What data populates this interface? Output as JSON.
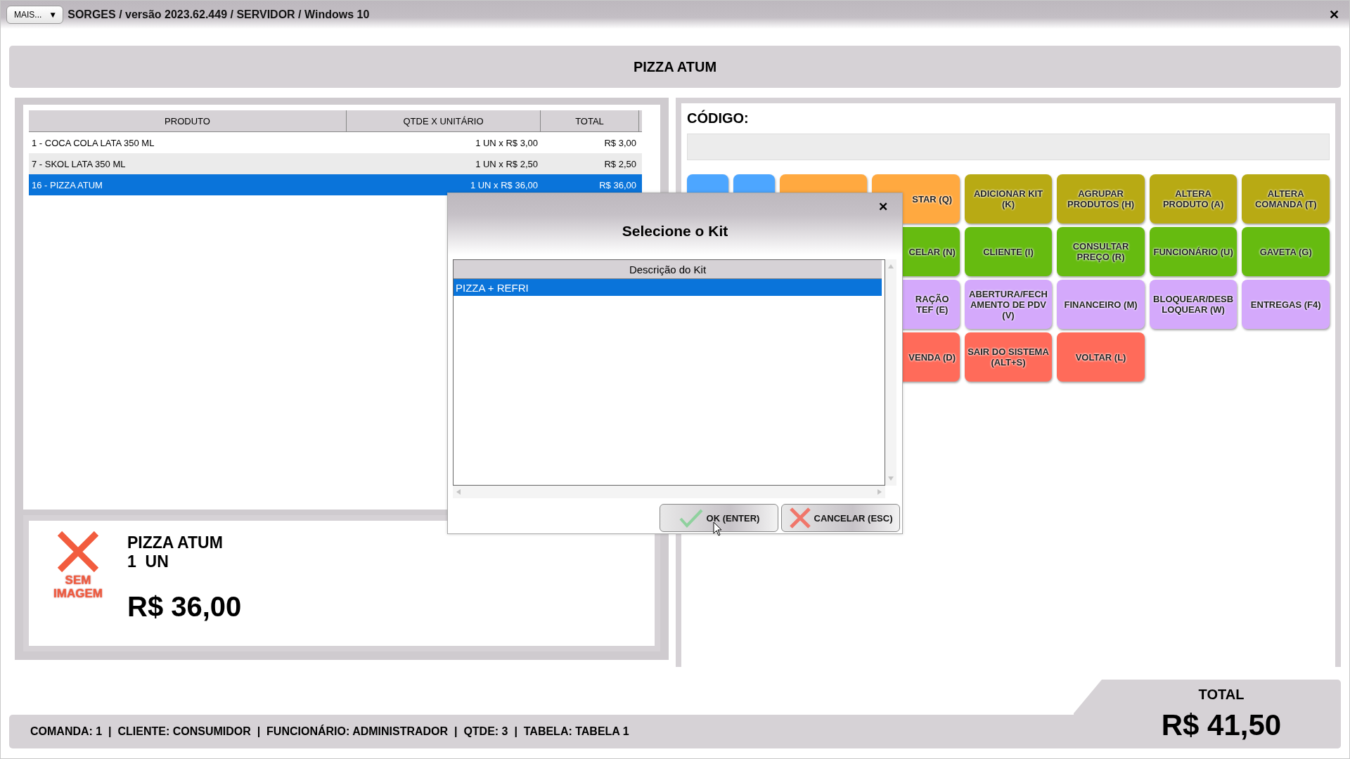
{
  "title_bar": {
    "menu_button": "MAIS...",
    "menu_caret": "▼",
    "title": "SORGES / versão 2023.62.449 / SERVIDOR / Windows 10",
    "close": "✕"
  },
  "header": {
    "product": "PIZZA ATUM"
  },
  "items_table": {
    "columns": [
      "PRODUTO",
      "QTDE X UNITÁRIO",
      "TOTAL"
    ],
    "rows": [
      {
        "product": "1 - COCA COLA LATA 350 ML",
        "quantity": "1 UN x R$ 3,00",
        "total": "R$ 3,00",
        "selected": false
      },
      {
        "product": "7 - SKOL LATA 350 ML",
        "quantity": "1 UN x R$ 2,50",
        "total": "R$ 2,50",
        "selected": false
      },
      {
        "product": "16 - PIZZA ATUM",
        "quantity": "1 UN x R$ 36,00",
        "total": "R$ 36,00",
        "selected": true
      }
    ]
  },
  "product_card": {
    "no_image": "SEM IMAGEM",
    "name": "PIZZA ATUM",
    "quantity": "1  UN",
    "price": "R$ 36,00"
  },
  "code_field": {
    "label": "CÓDIGO:"
  },
  "function_button_rows": [
    [
      {
        "kind": "half",
        "color": "#4da6ff"
      },
      {
        "kind": "half",
        "color": "#4da6ff"
      },
      {
        "kind": "full",
        "color": "#ffa940"
      },
      {
        "kind": "partial",
        "label": "STAR (Q)",
        "color": "#ffa940"
      },
      {
        "kind": "full",
        "label": "ADICIONAR KIT (K)",
        "color": "#b8aa14"
      },
      {
        "kind": "full",
        "label": "AGRUPAR PRODUTOS (H)",
        "color": "#b8aa14"
      },
      {
        "kind": "full",
        "label": "ALTERA PRODUTO (A)",
        "color": "#b8aa14"
      },
      {
        "kind": "full",
        "label": "ALTERA COMANDA (T)",
        "color": "#b8aa14"
      }
    ],
    [
      {
        "kind": "partial",
        "label": "CELAR (N)",
        "color": "#66bb10"
      },
      {
        "kind": "full",
        "label": "CLIENTE (I)",
        "color": "#66bb10"
      },
      {
        "kind": "full",
        "label": "CONSULTAR PREÇO (R)",
        "color": "#66bb10"
      },
      {
        "kind": "full",
        "label": "FUNCIONÁRIO (U)",
        "color": "#66bb10"
      },
      {
        "kind": "full",
        "label": "GAVETA (G)",
        "color": "#66bb10"
      }
    ],
    [
      {
        "kind": "partial",
        "label": "RAÇÃO TEF (E)",
        "color": "#d4a9fb"
      },
      {
        "kind": "full",
        "label": "ABERTURA/FECHAMENTO DE PDV (V)",
        "color": "#d4a9fb"
      },
      {
        "kind": "full",
        "label": "FINANCEIRO (M)",
        "color": "#d4a9fb"
      },
      {
        "kind": "full",
        "label": "BLOQUEAR/DESBLOQUEAR (W)",
        "color": "#d4a9fb"
      },
      {
        "kind": "full",
        "label": "ENTREGAS (F4)",
        "color": "#d4a9fb"
      }
    ],
    [
      {
        "kind": "partial",
        "label": "VENDA (D)",
        "color": "#ff6b5a"
      },
      {
        "kind": "full",
        "label": "SAIR DO SISTEMA (ALT+S)",
        "color": "#ff6b5a"
      },
      {
        "kind": "full",
        "label": "VOLTAR (L)",
        "color": "#ff6b5a"
      }
    ]
  ],
  "status_bar": {
    "text": "COMANDA: 1  |  CLIENTE: CONSUMIDOR  |  FUNCIONÁRIO: ADMINISTRADOR  |  QTDE: 3  |  TABELA: TABELA 1"
  },
  "total": {
    "label": "TOTAL",
    "value": "R$ 41,50"
  },
  "dialog": {
    "close": "✕",
    "title": "Selecione o Kit",
    "column": "Descrição do Kit",
    "rows": [
      {
        "label": "PIZZA + REFRI",
        "selected": true
      }
    ],
    "buttons": [
      {
        "kind": "ok",
        "label": "OK (ENTER)"
      },
      {
        "kind": "cancel",
        "label": "CANCELAR (ESC)"
      }
    ]
  }
}
